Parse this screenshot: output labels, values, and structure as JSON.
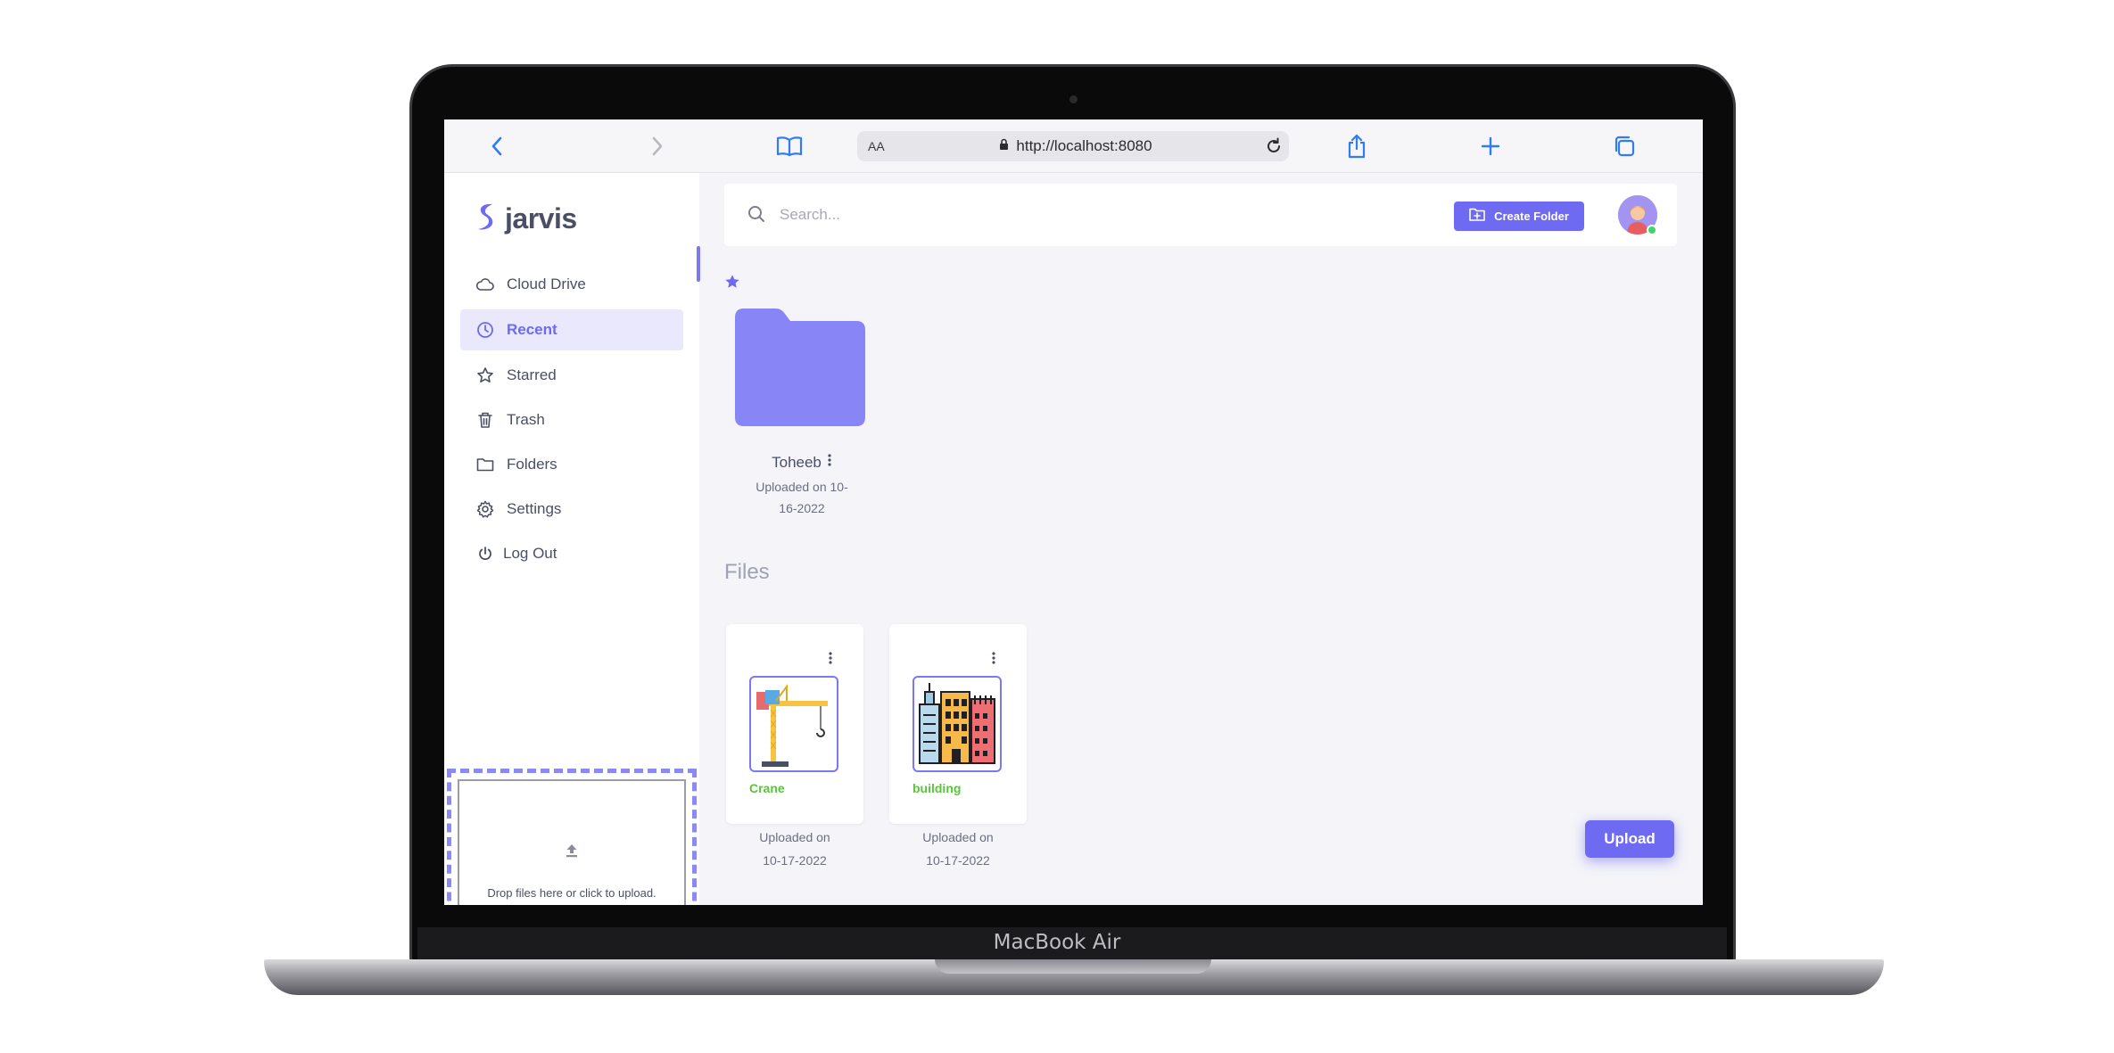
{
  "device": {
    "model_label": "MacBook Air"
  },
  "browser": {
    "aa_label": "AA",
    "url": "http://localhost:8080"
  },
  "app": {
    "brand": "jarvis",
    "accent_color": "#6e6af1"
  },
  "sidebar": {
    "items": [
      {
        "label": "Cloud Drive",
        "icon": "cloud-icon",
        "active": false
      },
      {
        "label": "Recent",
        "icon": "clock-icon",
        "active": true
      },
      {
        "label": "Starred",
        "icon": "star-icon",
        "active": false
      },
      {
        "label": "Trash",
        "icon": "trash-icon",
        "active": false
      },
      {
        "label": "Folders",
        "icon": "folder-icon",
        "active": false
      },
      {
        "label": "Settings",
        "icon": "gear-icon",
        "active": false
      },
      {
        "label": "Log Out",
        "icon": "power-icon",
        "active": false
      }
    ],
    "dropzone_text": "Drop files here or click to upload."
  },
  "header": {
    "search_placeholder": "Search...",
    "create_folder_label": "Create Folder"
  },
  "folders": [
    {
      "name": "Toheeb",
      "date_line1": "Uploaded on 10-",
      "date_line2": "16-2022"
    }
  ],
  "files_heading": "Files",
  "files": [
    {
      "name": "Crane",
      "date_line1": "Uploaded on",
      "date_line2": "10-17-2022",
      "thumb": "crane-image"
    },
    {
      "name": "building",
      "date_line1": "Uploaded on",
      "date_line2": "10-17-2022",
      "thumb": "building-image"
    }
  ],
  "upload_label": "Upload"
}
